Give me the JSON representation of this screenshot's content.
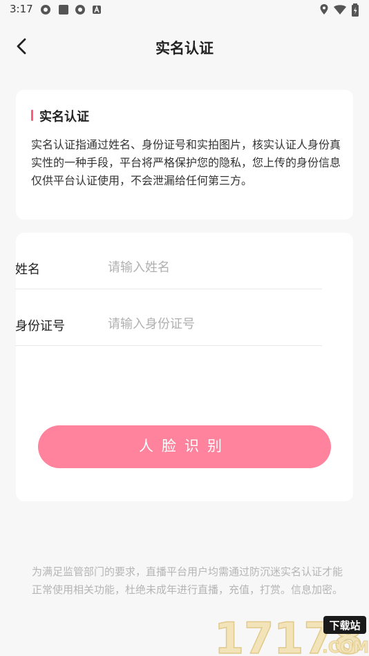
{
  "status_bar": {
    "time": "3:17"
  },
  "header": {
    "title": "实名认证"
  },
  "intro": {
    "heading": "实名认证",
    "description": "实名认证指通过姓名、身份证号和实拍图片，核实认证人身份真实性的一种手段，平台将严格保护您的隐私，您上传的身份信息仅供平台认证使用，不会泄漏给任何第三方。"
  },
  "form": {
    "name_label": "姓名",
    "name_placeholder": "请输入姓名",
    "id_label": "身份证号",
    "id_placeholder": "请输入身份证号",
    "face_button": "人脸识别"
  },
  "footer": {
    "note": "为满足监管部门的要求，直播平台用户均需通过防沉迷实名认证才能正常使用相关功能，杜绝未成年进行直播，充值，打赏。信息加密。"
  },
  "watermark": {
    "text": "17178",
    "badge": "下载站",
    "suffix": ".COM"
  },
  "colors": {
    "accent": "#ff5b7a",
    "button": "#ff839c",
    "background": "#f7f7f7"
  }
}
